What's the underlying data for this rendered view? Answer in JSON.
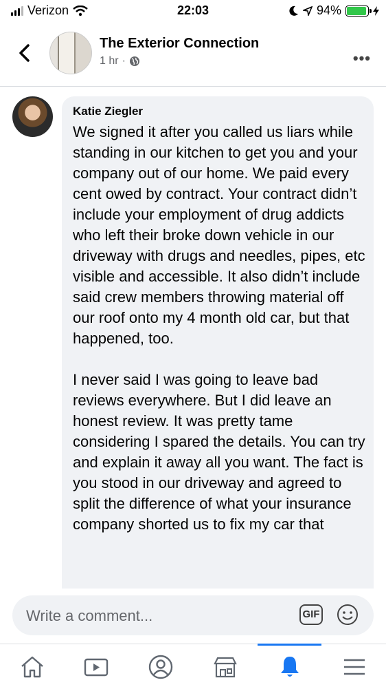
{
  "status_bar": {
    "carrier": "Verizon",
    "time": "22:03",
    "battery": "94%",
    "battery_level": 0.94
  },
  "header": {
    "page_name": "The Exterior Connection",
    "timestamp": "1 hr",
    "separator": "·"
  },
  "comment": {
    "author": "Katie Ziegler",
    "paragraphs": [
      "We signed it after you called us liars while standing in our kitchen to get you and your company out of our home. We paid every cent owed by contract. Your contract didn’t include your employment of drug addicts who left their broke down vehicle in our driveway with drugs and needles, pipes, etc visible and accessible. It also didn’t include said crew members throwing material off our roof onto my 4 month old car, but that happened, too.",
      "I never said I was going to leave bad reviews everywhere. But I did leave an honest review. It was pretty tame considering I spared the details. You can try and explain it away all you want. The fact is you stood in our driveway and agreed to split the difference of what your insurance company shorted us to fix my car that"
    ]
  },
  "composer": {
    "placeholder": "Write a comment...",
    "gif_label": "GIF"
  },
  "tabs": [
    {
      "icon": "home-icon"
    },
    {
      "icon": "video-icon"
    },
    {
      "icon": "profile-icon"
    },
    {
      "icon": "marketplace-icon"
    },
    {
      "icon": "notifications-icon",
      "active": true
    },
    {
      "icon": "menu-icon"
    }
  ],
  "colors": {
    "accent": "#1877f2",
    "bubble": "#f0f2f5",
    "battery": "#32c74a"
  }
}
